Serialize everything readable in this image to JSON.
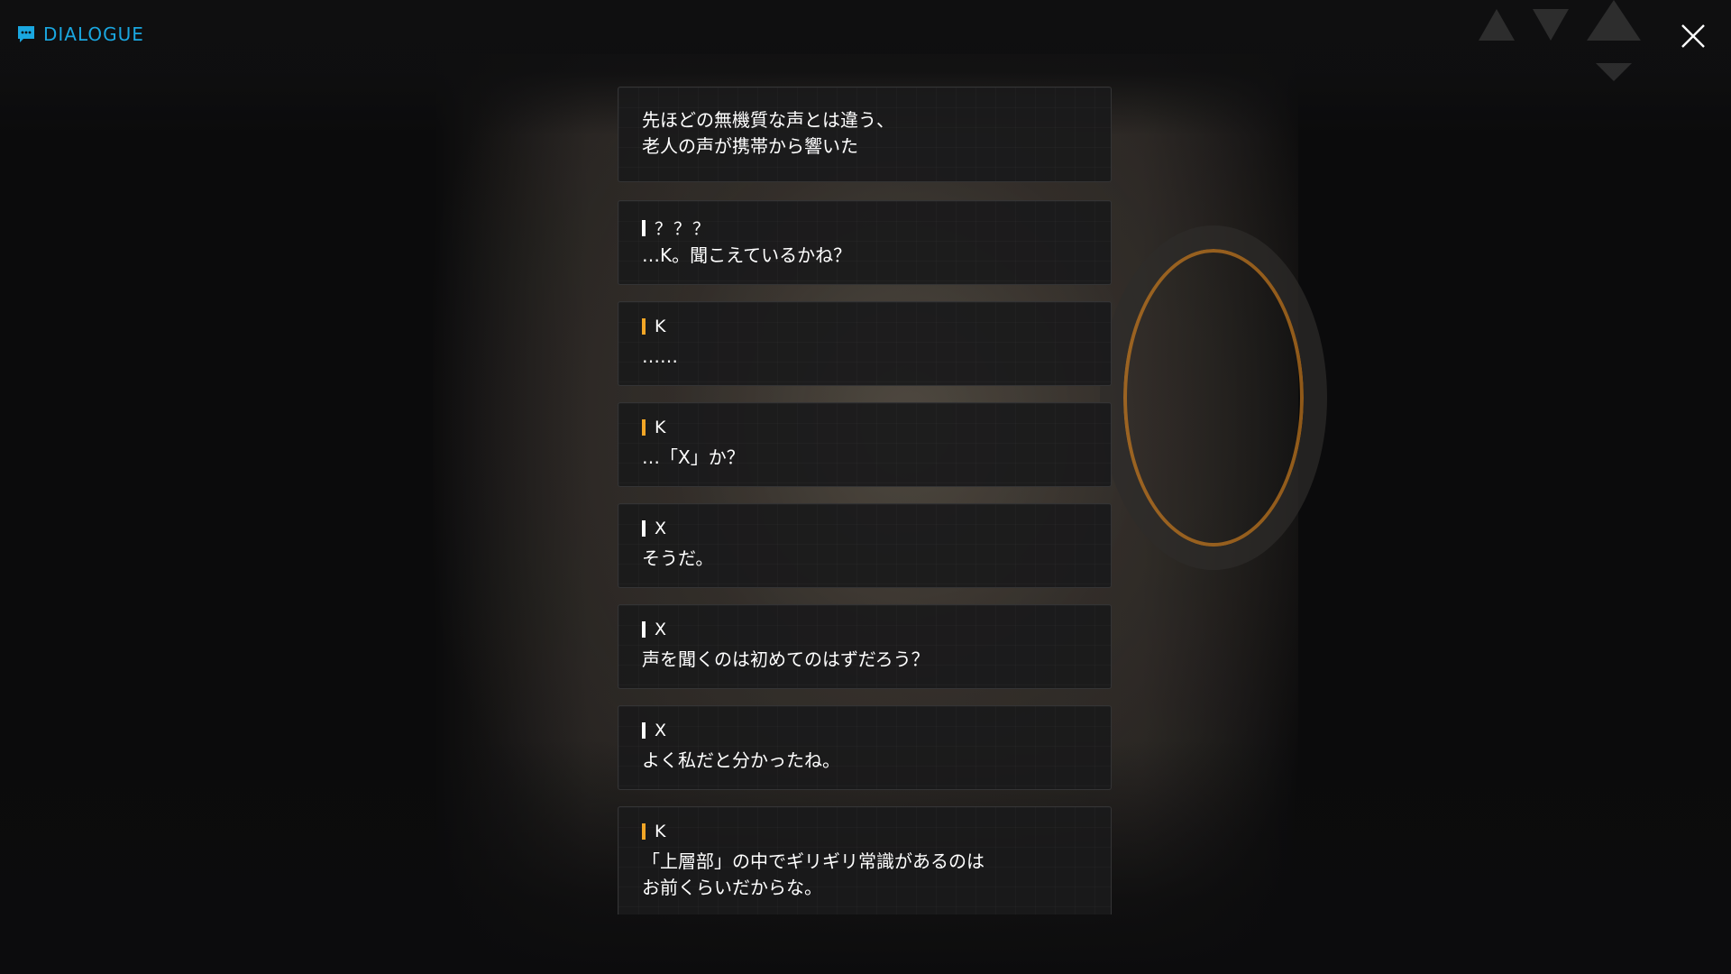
{
  "header": {
    "title": "DIALOGUE",
    "accent_color": "#1aa7e0",
    "icon": "chat-bubble-icon",
    "close_icon": "close-icon"
  },
  "speaker_colors": {
    "default": "#ffffff",
    "player": "#f2a626"
  },
  "entries": [
    {
      "speaker": "",
      "text": "先ほどの無機質な声とは違う、\n老人の声が携帯から響いた"
    },
    {
      "speaker": "？？？",
      "text": "…K。聞こえているかね？"
    },
    {
      "speaker": "K",
      "text": "……"
    },
    {
      "speaker": "K",
      "text": "…「X」か？"
    },
    {
      "speaker": "X",
      "text": "そうだ。"
    },
    {
      "speaker": "X",
      "text": "声を聞くのは初めてのはずだろう？"
    },
    {
      "speaker": "X",
      "text": "よく私だと分かったね。"
    },
    {
      "speaker": "K",
      "text": "「上層部」の中でギリギリ常識があるのは\nお前くらいだからな。"
    }
  ]
}
